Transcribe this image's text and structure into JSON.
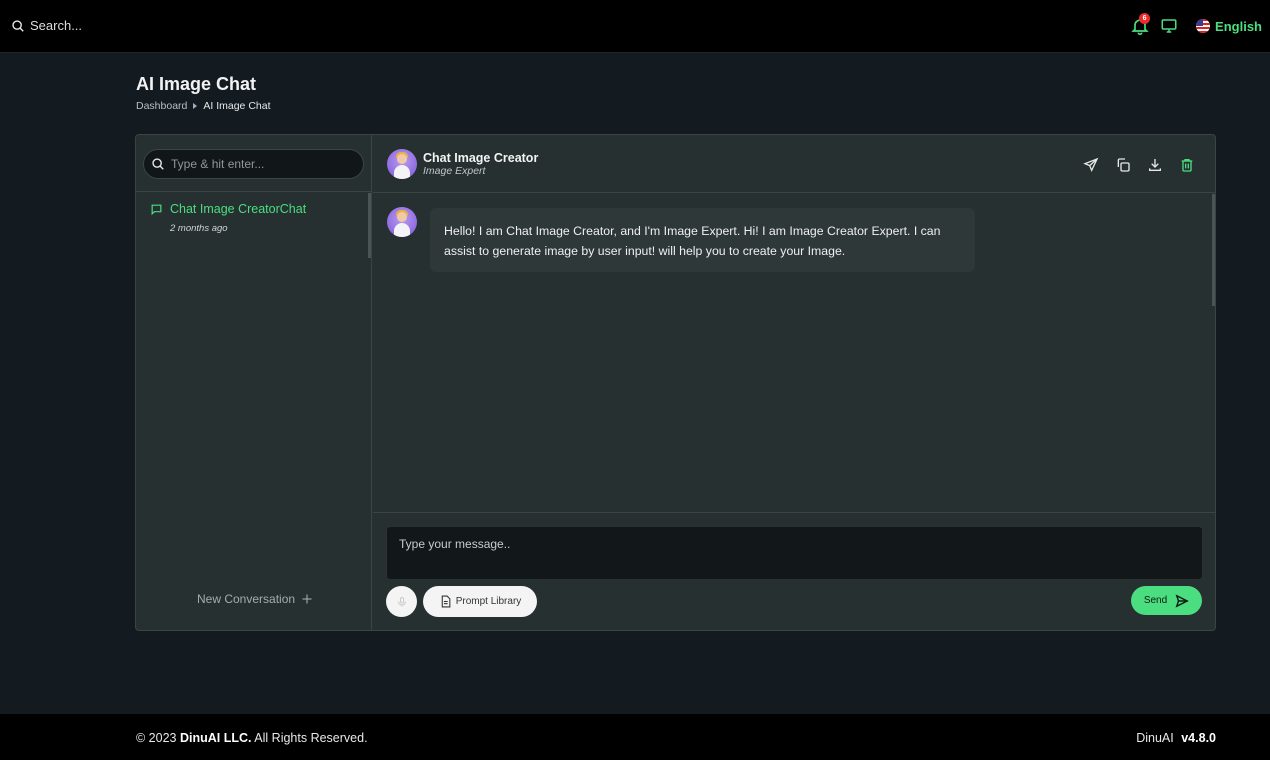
{
  "topbar": {
    "search_label": "Search...",
    "notification_count": "6",
    "language": "English"
  },
  "header": {
    "title": "AI Image Chat",
    "breadcrumb": [
      "Dashboard",
      "AI Image Chat"
    ]
  },
  "sidebar": {
    "search_placeholder": "Type & hit enter...",
    "conversations": [
      {
        "title": "Chat Image CreatorChat",
        "time": "2 months ago"
      }
    ],
    "new_conversation_label": "New Conversation"
  },
  "chat": {
    "bot_name": "Chat Image Creator",
    "bot_role": "Image Expert",
    "messages": [
      {
        "text": "Hello! I am Chat Image Creator, and I'm Image Expert. Hi! I am Image Creator Expert. I can assist to generate image by user input! will help you to create your Image."
      }
    ],
    "input_placeholder": "Type your message..",
    "prompt_library_label": "Prompt Library",
    "send_label": "Send"
  },
  "footer": {
    "copyright_prefix": "© 2023",
    "company": "DinuAI LLC.",
    "rights": "All Rights Reserved.",
    "product": "DinuAI",
    "version": "v4.8.0"
  },
  "colors": {
    "accent": "#4ade80",
    "background": "#131a20",
    "card": "#273030",
    "badge": "#ef2b2b"
  }
}
